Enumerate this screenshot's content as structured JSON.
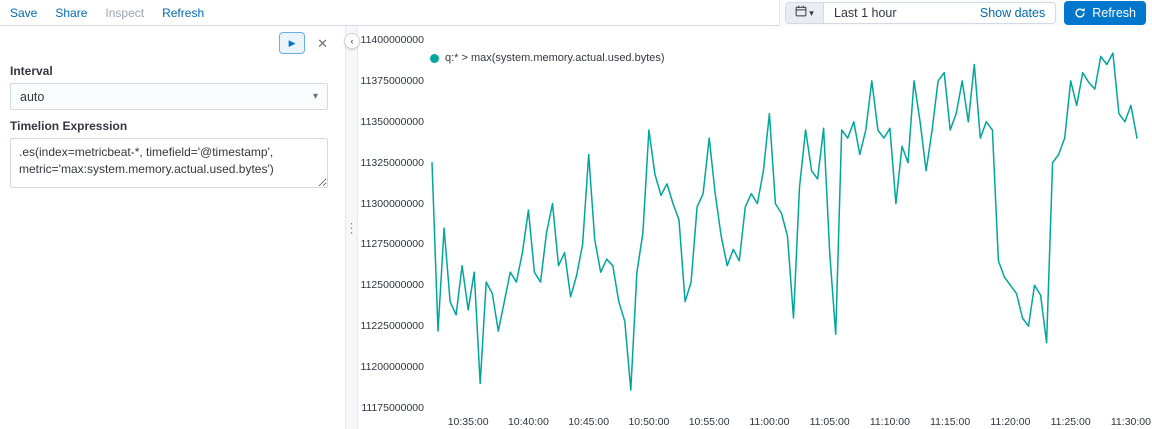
{
  "top_nav": {
    "items": [
      {
        "label": "Save"
      },
      {
        "label": "Share"
      },
      {
        "label": "Inspect"
      },
      {
        "label": "Refresh"
      }
    ]
  },
  "date_picker": {
    "duration": "Last 1 hour",
    "show_dates_label": "Show dates",
    "refresh_label": "Refresh"
  },
  "editor": {
    "interval_label": "Interval",
    "interval_value": "auto",
    "expression_label": "Timelion Expression",
    "expression_value": ".es(index=metricbeat-*, timefield='@timestamp', metric='max:system.memory.actual.used.bytes')"
  },
  "icons": {
    "play": "▶",
    "close": "✕",
    "chevron_down": "▾",
    "drag_dots": "⋮",
    "collapse_left": "‹"
  },
  "chart_data": {
    "type": "line",
    "title": "",
    "legend": "q:* > max(system.memory.actual.used.bytes)",
    "color": "#00a69b",
    "grid": false,
    "legend_position": "top-left",
    "ylim": [
      11175000000,
      11400000000
    ],
    "xlim": [
      "10:32:00",
      "11:31:15"
    ],
    "y_ticks": [
      "11400000000",
      "11375000000",
      "11350000000",
      "11325000000",
      "11300000000",
      "11275000000",
      "11250000000",
      "11225000000",
      "11200000000",
      "11175000000"
    ],
    "x_ticks": [
      "10:35:00",
      "10:40:00",
      "10:45:00",
      "10:50:00",
      "10:55:00",
      "11:00:00",
      "11:05:00",
      "11:10:00",
      "11:15:00",
      "11:20:00",
      "11:25:00",
      "11:30:00"
    ],
    "x": [
      "10:32:00",
      "10:32:30",
      "10:33:00",
      "10:33:30",
      "10:34:00",
      "10:34:30",
      "10:35:00",
      "10:35:30",
      "10:36:00",
      "10:36:30",
      "10:37:00",
      "10:37:30",
      "10:38:00",
      "10:38:30",
      "10:39:00",
      "10:39:30",
      "10:40:00",
      "10:40:30",
      "10:41:00",
      "10:41:30",
      "10:42:00",
      "10:42:30",
      "10:43:00",
      "10:43:30",
      "10:44:00",
      "10:44:30",
      "10:45:00",
      "10:45:30",
      "10:46:00",
      "10:46:30",
      "10:47:00",
      "10:47:30",
      "10:48:00",
      "10:48:30",
      "10:49:00",
      "10:49:30",
      "10:50:00",
      "10:50:30",
      "10:51:00",
      "10:51:30",
      "10:52:00",
      "10:52:30",
      "10:53:00",
      "10:53:30",
      "10:54:00",
      "10:54:30",
      "10:55:00",
      "10:55:30",
      "10:56:00",
      "10:56:30",
      "10:57:00",
      "10:57:30",
      "10:58:00",
      "10:58:30",
      "10:59:00",
      "10:59:30",
      "11:00:00",
      "11:00:30",
      "11:01:00",
      "11:01:30",
      "11:02:00",
      "11:02:30",
      "11:03:00",
      "11:03:30",
      "11:04:00",
      "11:04:30",
      "11:05:00",
      "11:05:30",
      "11:06:00",
      "11:06:30",
      "11:07:00",
      "11:07:30",
      "11:08:00",
      "11:08:30",
      "11:09:00",
      "11:09:30",
      "11:10:00",
      "11:10:30",
      "11:11:00",
      "11:11:30",
      "11:12:00",
      "11:12:30",
      "11:13:00",
      "11:13:30",
      "11:14:00",
      "11:14:30",
      "11:15:00",
      "11:15:30",
      "11:16:00",
      "11:16:30",
      "11:17:00",
      "11:17:30",
      "11:18:00",
      "11:18:30",
      "11:19:00",
      "11:19:30",
      "11:20:00",
      "11:20:30",
      "11:21:00",
      "11:21:30",
      "11:22:00",
      "11:22:30",
      "11:23:00",
      "11:23:30",
      "11:24:00",
      "11:24:30",
      "11:25:00",
      "11:25:30",
      "11:26:00",
      "11:26:30",
      "11:27:00",
      "11:27:30",
      "11:28:00",
      "11:28:30",
      "11:29:00",
      "11:29:30",
      "11:30:00",
      "11:30:30"
    ],
    "values": [
      11325000000,
      11222000000,
      11285000000,
      11240000000,
      11232000000,
      11262000000,
      11235000000,
      11258000000,
      11190000000,
      11252000000,
      11245000000,
      11222000000,
      11240000000,
      11258000000,
      11252000000,
      11270000000,
      11296000000,
      11258000000,
      11252000000,
      11282000000,
      11300000000,
      11262000000,
      11270000000,
      11243000000,
      11256000000,
      11275000000,
      11330000000,
      11278000000,
      11258000000,
      11266000000,
      11262000000,
      11240000000,
      11228000000,
      11186000000,
      11258000000,
      11282000000,
      11345000000,
      11318000000,
      11305000000,
      11312000000,
      11300000000,
      11290000000,
      11240000000,
      11252000000,
      11298000000,
      11306000000,
      11340000000,
      11306000000,
      11280000000,
      11262000000,
      11272000000,
      11265000000,
      11298000000,
      11306000000,
      11300000000,
      11320000000,
      11355000000,
      11300000000,
      11294000000,
      11280000000,
      11230000000,
      11310000000,
      11345000000,
      11320000000,
      11315000000,
      11346000000,
      11270000000,
      11220000000,
      11345000000,
      11340000000,
      11350000000,
      11330000000,
      11345000000,
      11375000000,
      11345000000,
      11340000000,
      11346000000,
      11300000000,
      11335000000,
      11325000000,
      11375000000,
      11350000000,
      11320000000,
      11345000000,
      11375000000,
      11380000000,
      11345000000,
      11355000000,
      11375000000,
      11350000000,
      11385000000,
      11340000000,
      11350000000,
      11345000000,
      11265000000,
      11255000000,
      11250000000,
      11245000000,
      11230000000,
      11225000000,
      11250000000,
      11244000000,
      11215000000,
      11325000000,
      11330000000,
      11340000000,
      11375000000,
      11360000000,
      11380000000,
      11374000000,
      11370000000,
      11390000000,
      11385000000,
      11392000000,
      11355000000,
      11350000000,
      11360000000,
      11340000000
    ]
  }
}
